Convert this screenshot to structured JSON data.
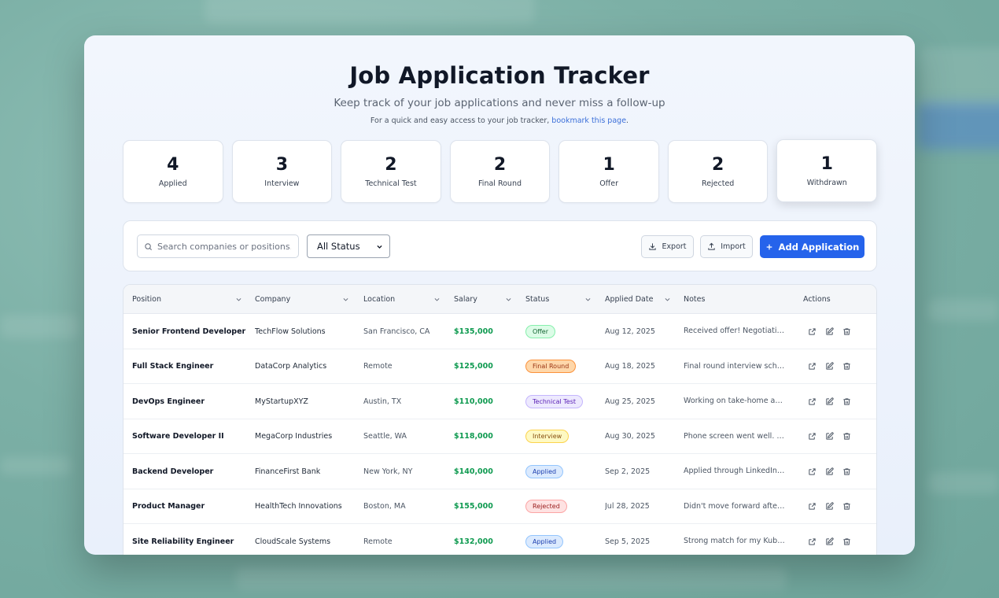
{
  "header": {
    "title": "Job Application Tracker",
    "subtitle": "Keep track of your job applications and never miss a follow-up",
    "hint_prefix": "For a quick and easy access to your job tracker, ",
    "hint_link": "bookmark this page",
    "hint_suffix": "."
  },
  "stats": [
    {
      "count": "4",
      "label": "Applied"
    },
    {
      "count": "3",
      "label": "Interview"
    },
    {
      "count": "2",
      "label": "Technical Test"
    },
    {
      "count": "2",
      "label": "Final Round"
    },
    {
      "count": "1",
      "label": "Offer"
    },
    {
      "count": "2",
      "label": "Rejected"
    },
    {
      "count": "1",
      "label": "Withdrawn"
    }
  ],
  "toolbar": {
    "search_placeholder": "Search companies or positions...",
    "status_filter": "All Status",
    "export_label": "Export",
    "import_label": "Import",
    "add_label": "Add Application"
  },
  "table": {
    "columns": [
      "Position",
      "Company",
      "Location",
      "Salary",
      "Status",
      "Applied Date",
      "Notes",
      "Actions"
    ],
    "rows": [
      {
        "position": "Senior Frontend Developer",
        "company": "TechFlow Solutions",
        "location": "San Francisco, CA",
        "salary": "$135,000",
        "status": "Offer",
        "date": "Aug 12, 2025",
        "notes": "Received offer! Negotiating s..."
      },
      {
        "position": "Full Stack Engineer",
        "company": "DataCorp Analytics",
        "location": "Remote",
        "salary": "$125,000",
        "status": "Final Round",
        "date": "Aug 18, 2025",
        "notes": "Final round interview schedul..."
      },
      {
        "position": "DevOps Engineer",
        "company": "MyStartupXYZ",
        "location": "Austin, TX",
        "salary": "$110,000",
        "status": "Technical Test",
        "date": "Aug 25, 2025",
        "notes": "Working on take-home assig..."
      },
      {
        "position": "Software Developer II",
        "company": "MegaCorp Industries",
        "location": "Seattle, WA",
        "salary": "$118,000",
        "status": "Interview",
        "date": "Aug 30, 2025",
        "notes": "Phone screen went well. Sch..."
      },
      {
        "position": "Backend Developer",
        "company": "FinanceFirst Bank",
        "location": "New York, NY",
        "salary": "$140,000",
        "status": "Applied",
        "date": "Sep 2, 2025",
        "notes": "Applied through LinkedIn. Ba..."
      },
      {
        "position": "Product Manager",
        "company": "HealthTech Innovations",
        "location": "Boston, MA",
        "salary": "$155,000",
        "status": "Rejected",
        "date": "Jul 28, 2025",
        "notes": "Didn't move forward after ini..."
      },
      {
        "position": "Site Reliability Engineer",
        "company": "CloudScale Systems",
        "location": "Remote",
        "salary": "$132,000",
        "status": "Applied",
        "date": "Sep 5, 2025",
        "notes": "Strong match for my Kubern..."
      }
    ]
  },
  "status_colors": {
    "Offer": {
      "bg": "#dcfce7",
      "border": "#86efac",
      "text": "#166534"
    },
    "Final Round": {
      "bg": "#fed7aa",
      "border": "#fb923c",
      "text": "#9a3412"
    },
    "Technical Test": {
      "bg": "#ede9fe",
      "border": "#c4b5fd",
      "text": "#5b21b6"
    },
    "Interview": {
      "bg": "#fef9c3",
      "border": "#fcd34d",
      "text": "#854d0e"
    },
    "Applied": {
      "bg": "#dbeafe",
      "border": "#93c5fd",
      "text": "#1e40af"
    },
    "Rejected": {
      "bg": "#fee2e2",
      "border": "#fca5a5",
      "text": "#991b1b"
    }
  },
  "colors": {
    "primary": "#2563eb",
    "salary": "#0f9a50",
    "link": "#3b6fd9"
  }
}
